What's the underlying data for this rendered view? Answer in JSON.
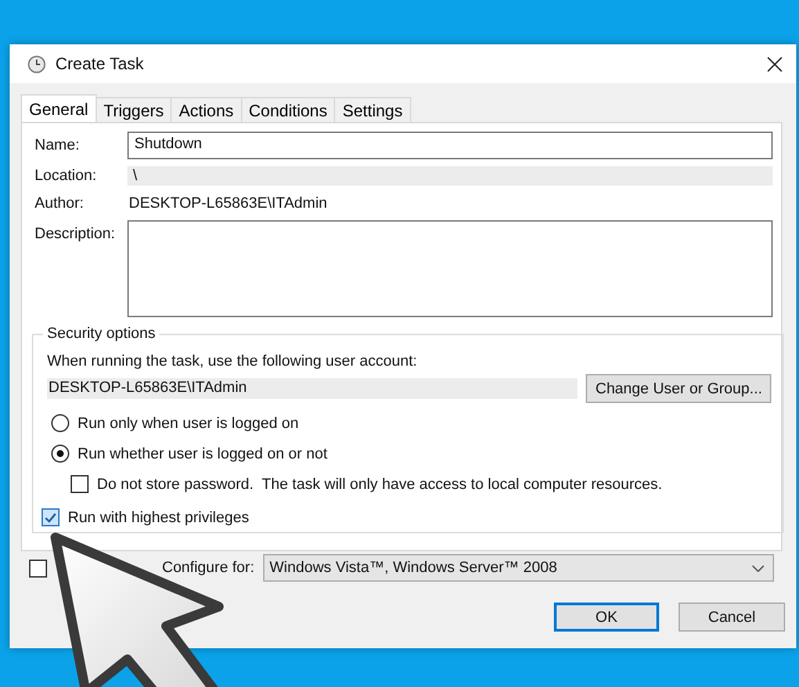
{
  "window": {
    "title": "Create Task"
  },
  "tabs": [
    {
      "label": "General",
      "selected": true
    },
    {
      "label": "Triggers",
      "selected": false
    },
    {
      "label": "Actions",
      "selected": false
    },
    {
      "label": "Conditions",
      "selected": false
    },
    {
      "label": "Settings",
      "selected": false
    }
  ],
  "fields": [
    {
      "label": "Name:",
      "kind": "input",
      "value": "Shutdown"
    },
    {
      "label": "Location:",
      "kind": "readonly",
      "value": "\\"
    },
    {
      "label": "Author:",
      "kind": "text",
      "value": "DESKTOP-L65863E\\ITAdmin"
    },
    {
      "label": "Description:",
      "kind": "textarea"
    }
  ],
  "security": {
    "legend": "Security options",
    "prompt": "When running the task, use the following user account:",
    "account": "DESKTOP-L65863E\\ITAdmin",
    "change_button": "Change User or Group...",
    "logon_options": [
      {
        "label": "Run only when user is logged on",
        "selected": false
      },
      {
        "label": "Run whether user is logged on or not",
        "selected": true
      }
    ],
    "store_password": {
      "label": "Do not store password.  The task will only have access to local computer resources.",
      "checked": false
    },
    "highest_privileges": {
      "label": "Run with highest privileges",
      "checked": true
    }
  },
  "hidden": {
    "checked": false
  },
  "configure": {
    "label": "Configure for:",
    "value": "Windows Vista™, Windows Server™ 2008"
  },
  "buttons": [
    {
      "label": "OK",
      "kind": "default"
    },
    {
      "label": "Cancel",
      "kind": "normal"
    }
  ]
}
